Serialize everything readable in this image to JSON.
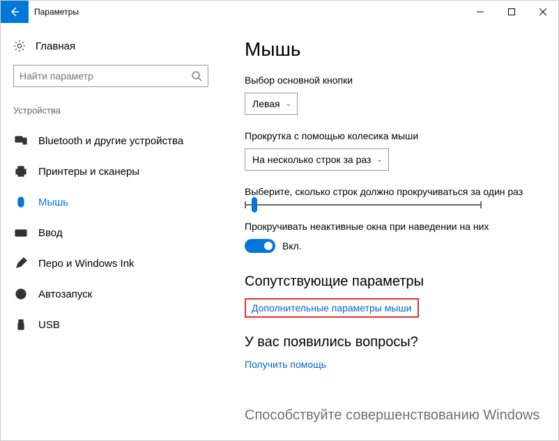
{
  "titlebar": {
    "title": "Параметры"
  },
  "left": {
    "home": "Главная",
    "search_placeholder": "Найти параметр",
    "category": "Устройства",
    "nav": {
      "bluetooth": "Bluetooth и другие устройства",
      "printers": "Принтеры и сканеры",
      "mouse": "Мышь",
      "typing": "Ввод",
      "pen": "Перо и Windows Ink",
      "autoplay": "Автозапуск",
      "usb": "USB"
    }
  },
  "main": {
    "heading": "Мышь",
    "primary_label": "Выбор основной кнопки",
    "primary_value": "Левая",
    "scroll_label": "Прокрутка с помощью колесика мыши",
    "scroll_value": "На несколько строк за раз",
    "lines_label": "Выберите, сколько строк должно прокручиваться за один раз",
    "inactive_label": "Прокручивать неактивные окна при наведении на них",
    "toggle_state": "Вкл.",
    "related_heading": "Сопутствующие параметры",
    "related_link": "Дополнительные параметры мыши",
    "help_heading": "У вас появились вопросы?",
    "help_link": "Получить помощь",
    "improve_heading": "Способствуйте совершенствованию Windows"
  }
}
